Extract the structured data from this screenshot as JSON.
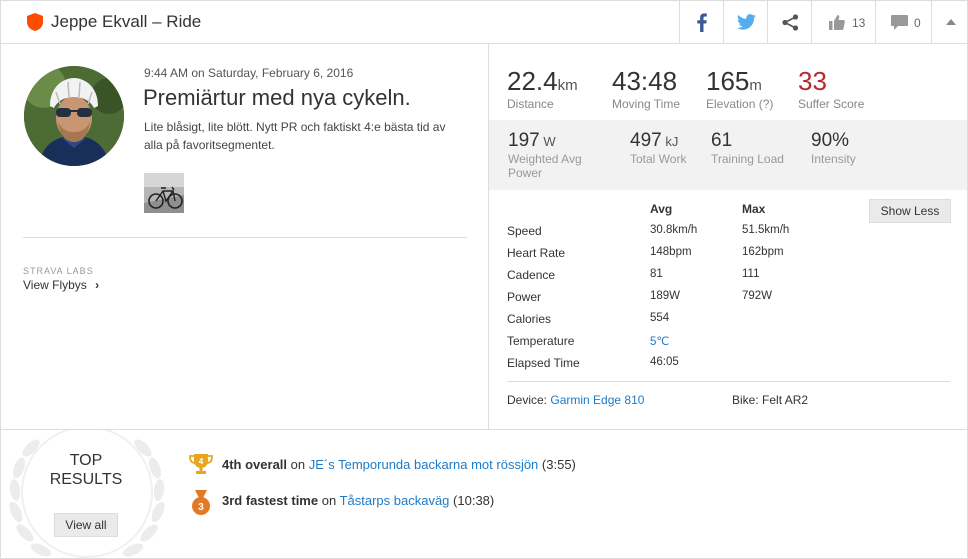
{
  "header": {
    "title": "Jeppe Ekvall – Ride",
    "kudos_count": "13",
    "comment_count": "0"
  },
  "activity": {
    "date": "9:44 AM on Saturday, February 6, 2016",
    "title": "Premiärtur med nya cykeln.",
    "description": "Lite blåsigt, lite blött. Nytt PR och faktiskt 4:e bästa tid av alla på favoritsegmentet.",
    "labs_label": "STRAVA LABS",
    "flybys_label": "View Flybys"
  },
  "primary_stats": [
    {
      "value": "22.4",
      "unit": "km",
      "label": "Distance"
    },
    {
      "value": "43:48",
      "unit": "",
      "label": "Moving Time"
    },
    {
      "value": "165",
      "unit": "m",
      "label": "Elevation (?)"
    },
    {
      "value": "33",
      "unit": "",
      "label": "Suffer Score"
    }
  ],
  "secondary_stats": [
    {
      "value": "197",
      "unit": "W",
      "label": "Weighted Avg Power"
    },
    {
      "value": "497",
      "unit": "kJ",
      "label": "Total Work"
    },
    {
      "value": "61",
      "unit": "",
      "label": "Training Load"
    },
    {
      "value": "90%",
      "unit": "",
      "label": "Intensity"
    }
  ],
  "details": {
    "avg_header": "Avg",
    "max_header": "Max",
    "show_less": "Show Less",
    "rows": [
      {
        "label": "Speed",
        "avg": "30.8km/h",
        "max": "51.5km/h"
      },
      {
        "label": "Heart Rate",
        "avg": "148bpm",
        "max": "162bpm"
      },
      {
        "label": "Cadence",
        "avg": "81",
        "max": "111"
      },
      {
        "label": "Power",
        "avg": "189W",
        "max": "792W"
      },
      {
        "label": "Calories",
        "avg": "554",
        "max": ""
      },
      {
        "label": "Temperature",
        "avg": "5℃",
        "max": ""
      },
      {
        "label": "Elapsed Time",
        "avg": "46:05",
        "max": ""
      }
    ],
    "device_label": "Device:",
    "device_value": "Garmin Edge 810",
    "bike_label": "Bike:",
    "bike_value": "Felt AR2"
  },
  "results": {
    "heading_line1": "TOP",
    "heading_line2": "RESULTS",
    "view_all": "View all",
    "items": [
      {
        "rank": "4th overall",
        "on": "on",
        "segment": "JE´s Temporunda backarna mot rössjön",
        "time": "(3:55)"
      },
      {
        "rank": "3rd fastest time",
        "on": "on",
        "segment": "Tåstarps backaväg",
        "time": "(10:38)"
      }
    ],
    "medal_number": "3"
  },
  "colors": {
    "brand_orange": "#fc4c02",
    "link_blue": "#1e7ac7",
    "suffer_red": "#b7272d",
    "gold": "#e8a61e",
    "bronze": "#e07a24"
  }
}
